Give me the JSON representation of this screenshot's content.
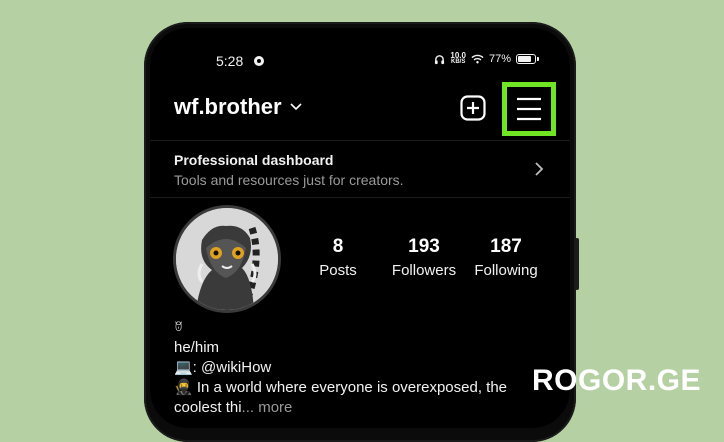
{
  "status": {
    "time": "5:28",
    "net_speed": "10.0",
    "net_unit": "KB/S",
    "battery": "77%"
  },
  "header": {
    "username": "wf.brother"
  },
  "dashboard": {
    "title": "Professional dashboard",
    "subtitle": "Tools and resources just for creators."
  },
  "stats": [
    {
      "value": "8",
      "label": "Posts"
    },
    {
      "value": "193",
      "label": "Followers"
    },
    {
      "value": "187",
      "label": "Following"
    }
  ],
  "bio": {
    "icon_line": "ꆤ",
    "pronouns": "he/him",
    "line2": "💻: @wikiHow",
    "line3": "🥷 In a world where everyone is overexposed, the",
    "line4_text": "coolest thi",
    "line4_more": "... more"
  },
  "watermark": "ROGOR.GE",
  "colors": {
    "background": "#b5d1a3",
    "highlight": "#6fe523"
  }
}
